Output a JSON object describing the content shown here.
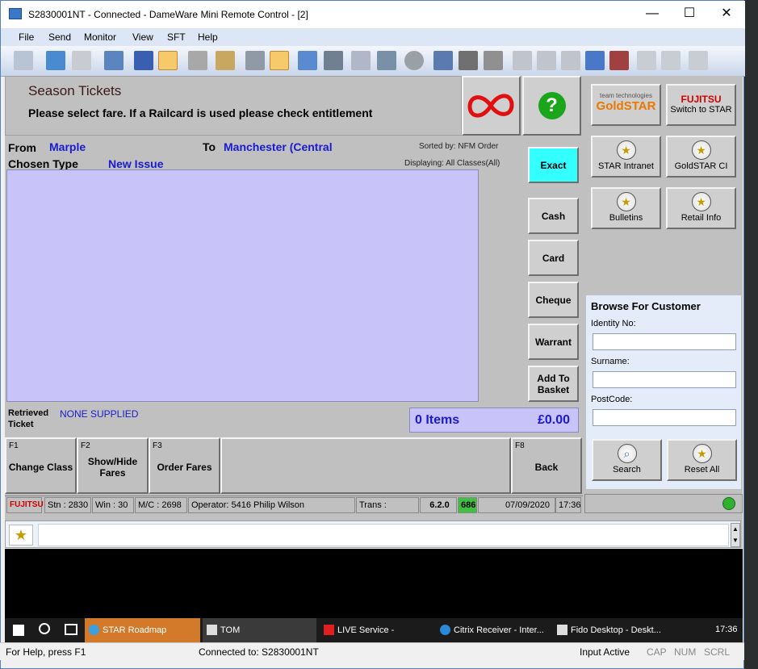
{
  "window": {
    "title": "S2830001NT - Connected - DameWare Mini Remote Control - [2]",
    "minimize": "—",
    "maximize": "☐",
    "close": "✕"
  },
  "menu": [
    "File",
    "Send",
    "Monitor",
    "View",
    "SFT",
    "Help"
  ],
  "header": {
    "title": "Season Tickets",
    "instruction": "Please select fare. If a Railcard is used please check entitlement"
  },
  "journey": {
    "from_label": "From",
    "from": "Marple",
    "to_label": "To",
    "to": "Manchester (Central",
    "type_label": "Chosen Type",
    "type": "New Issue",
    "sorted_by": "Sorted by:  NFM Order",
    "displaying": "Displaying: All Classes(All)"
  },
  "payment": {
    "exact": "Exact",
    "cash": "Cash",
    "card": "Card",
    "cheque": "Cheque",
    "warrant": "Warrant",
    "add_to_basket": "Add To Basket"
  },
  "retrieved": {
    "label1": "Retrieved",
    "label2": "Ticket",
    "value": "NONE SUPPLIED"
  },
  "totals": {
    "items": "0 Items",
    "amount": "£0.00"
  },
  "fkeys": {
    "f1_key": "F1",
    "f1_label": "Change Class",
    "f2_key": "F2",
    "f2_label": "Show/Hide Fares",
    "f3_key": "F3",
    "f3_label": "Order Fares",
    "f8_key": "F8",
    "f8_label": "Back"
  },
  "statusline": {
    "brand": "FUJITSU",
    "stn": "Stn :  2830",
    "win": "Win :  30",
    "mc": "M/C :  2698",
    "operator": "Operator:  5416  Philip    Wilson",
    "trans": "Trans :",
    "version": "6.2.0",
    "count": "686",
    "date": "07/09/2020",
    "time": "17:36"
  },
  "right": {
    "gold_top": "team technologies",
    "gold_main": "GoldSTAR",
    "fujitsu": "FUJITSU",
    "switch": "Switch to STAR",
    "star_intranet": "STAR Intranet",
    "goldstar_ci": "GoldSTAR CI",
    "bulletins": "Bulletins",
    "retail_info": "Retail Info"
  },
  "browse": {
    "title": "Browse For Customer",
    "identity": "Identity No:",
    "surname": "Surname:",
    "postcode": "PostCode:",
    "search": "Search",
    "reset": "Reset All"
  },
  "taskbar": {
    "items": [
      "STAR Roadmap",
      "TOM",
      "LIVE Service - Journey...",
      "Citrix Receiver - Inter...",
      "Fido Desktop - Deskt..."
    ],
    "clock": "17:36"
  },
  "status": {
    "help": "For Help, press F1",
    "connected": "Connected to: S2830001NT",
    "input": "Input Active",
    "cap": "CAP",
    "num": "NUM",
    "scrl": "SCRL"
  },
  "colors": {
    "list_bg": "#c8c4fa",
    "exact_bg": "#33ffff",
    "blue_text": "#1a1ad2",
    "goldstar": "#e87800",
    "fujitsu_red": "#d00000",
    "count_bg": "#40c040"
  }
}
